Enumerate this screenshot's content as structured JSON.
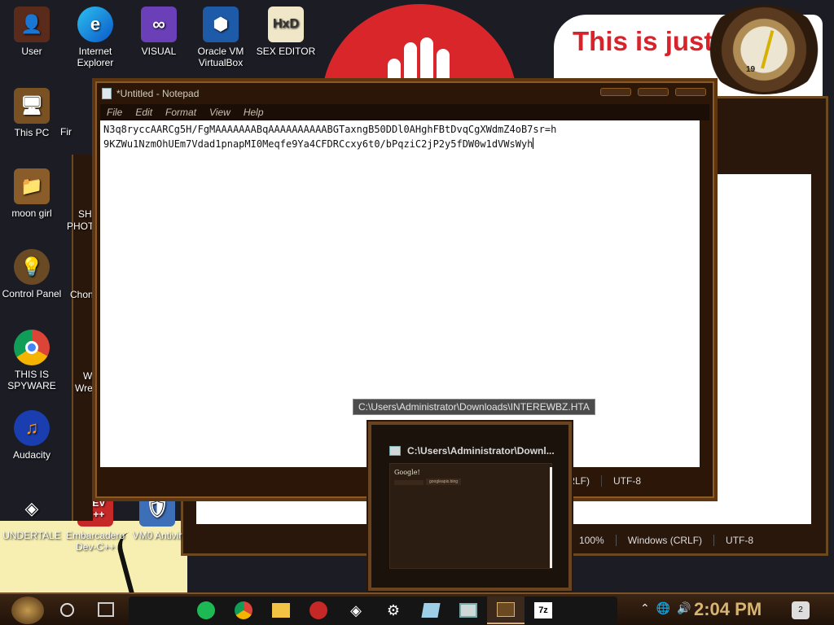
{
  "desktop": {
    "icons": [
      {
        "label": "User",
        "glyph": "user-icon"
      },
      {
        "label": "This PC",
        "glyph": "computer-icon"
      },
      {
        "label": "moon girl",
        "glyph": "folder-icon"
      },
      {
        "label": "Control Panel",
        "glyph": "control-panel-icon"
      },
      {
        "label": "THIS IS SPYWARE",
        "glyph": "chrome-icon"
      },
      {
        "label": "Audacity",
        "glyph": "audacity-icon"
      },
      {
        "label": "UNDERTALE",
        "glyph": "unity-icon"
      },
      {
        "label": "Internet Explorer",
        "glyph": "edge-icon"
      },
      {
        "label": "VISUAL",
        "glyph": "visual-studio-icon"
      },
      {
        "label": "Oracle VM VirtualBox",
        "glyph": "virtualbox-icon"
      },
      {
        "label": "SEX EDITOR",
        "glyph": "hex-editor-icon"
      },
      {
        "label": "Embarcadero Dev-C++",
        "glyph": "devcpp-icon"
      },
      {
        "label": "VM0 Antivir",
        "glyph": "antivirus-icon"
      }
    ],
    "partial_labels": [
      "Fir",
      "SH",
      "PHOTO",
      "Chon",
      "W",
      "Wre"
    ],
    "background_text": "This is just the George Ou"
  },
  "notepad": {
    "title": "*Untitled - Notepad",
    "menu": [
      "File",
      "Edit",
      "Format",
      "View",
      "Help"
    ],
    "text_lines": [
      "N3q8ryccAARCg5H/FgMAAAAAAABqAAAAAAAAAABGTaxngB50DDl0AHghFBtDvqCgXWdmZ4oB7sr=h",
      "9KZWu1NzmOhUEm7Vdad1pnapMI0Meqfe9Ya4CFDRCcxy6t0/bPqziC2jP2y5fDW0w1dVWsWyh"
    ],
    "status": {
      "line_ending": "(CRLF)",
      "encoding": "UTF-8"
    }
  },
  "back_window": {
    "status": {
      "zoom": "100%",
      "line_ending": "Windows (CRLF)",
      "encoding": "UTF-8"
    }
  },
  "tooltip": "C:\\Users\\Administrator\\Downloads\\INTEREWBZ.HTA",
  "preview": {
    "title": "C:\\Users\\Administrator\\Downl...",
    "thumb_title": "Google!",
    "thumb_button": "googleapis.bing"
  },
  "taskbar": {
    "apps": [
      "spotify-icon",
      "chrome-icon",
      "file-explorer-icon",
      "red-app-icon",
      "unity-icon",
      "settings-icon",
      "notepad-icon",
      "window-icon",
      "hta-app-icon",
      "7zip-icon"
    ],
    "time": "2:04 PM",
    "notification_count": "2"
  },
  "clock_face_number": "19"
}
